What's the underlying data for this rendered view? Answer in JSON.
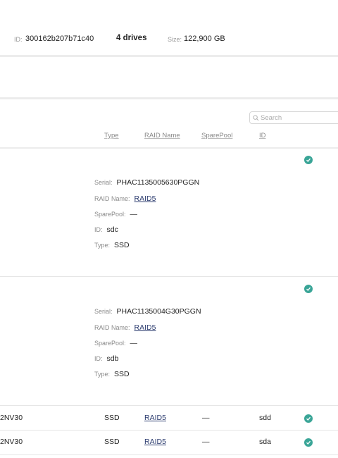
{
  "header": {
    "id_label": "ID:",
    "id_value": "300162b207b71c40",
    "drives": "4 drives",
    "size_label": "Size:",
    "size_value": "122,900 GB"
  },
  "search": {
    "placeholder": "Search"
  },
  "columns": {
    "type": "Type",
    "raid_name": "RAID Name",
    "spare_pool": "SparePool",
    "id": "ID"
  },
  "status_color": "#3aa597",
  "expanded": [
    {
      "serial_label": "Serial:",
      "serial": "PHAC1135005630PGGN",
      "raid_label": "RAID Name:",
      "raid": "RAID5",
      "spare_label": "SparePool:",
      "spare": "—",
      "id_label": "ID:",
      "id": "sdc",
      "type_label": "Type:",
      "type": "SSD",
      "status_icon": "check-circle-icon"
    },
    {
      "serial_label": "Serial:",
      "serial": "PHAC1135004G30PGGN",
      "raid_label": "RAID Name:",
      "raid": "RAID5",
      "spare_label": "SparePool:",
      "spare": "—",
      "id_label": "ID:",
      "id": "sdb",
      "type_label": "Type:",
      "type": "SSD",
      "status_icon": "check-circle-icon"
    }
  ],
  "rows": [
    {
      "name": "2NV30",
      "type": "SSD",
      "raid": "RAID5",
      "spare": "—",
      "id": "sdd",
      "status_icon": "check-circle-icon"
    },
    {
      "name": "2NV30",
      "type": "SSD",
      "raid": "RAID5",
      "spare": "—",
      "id": "sda",
      "status_icon": "check-circle-icon"
    }
  ]
}
